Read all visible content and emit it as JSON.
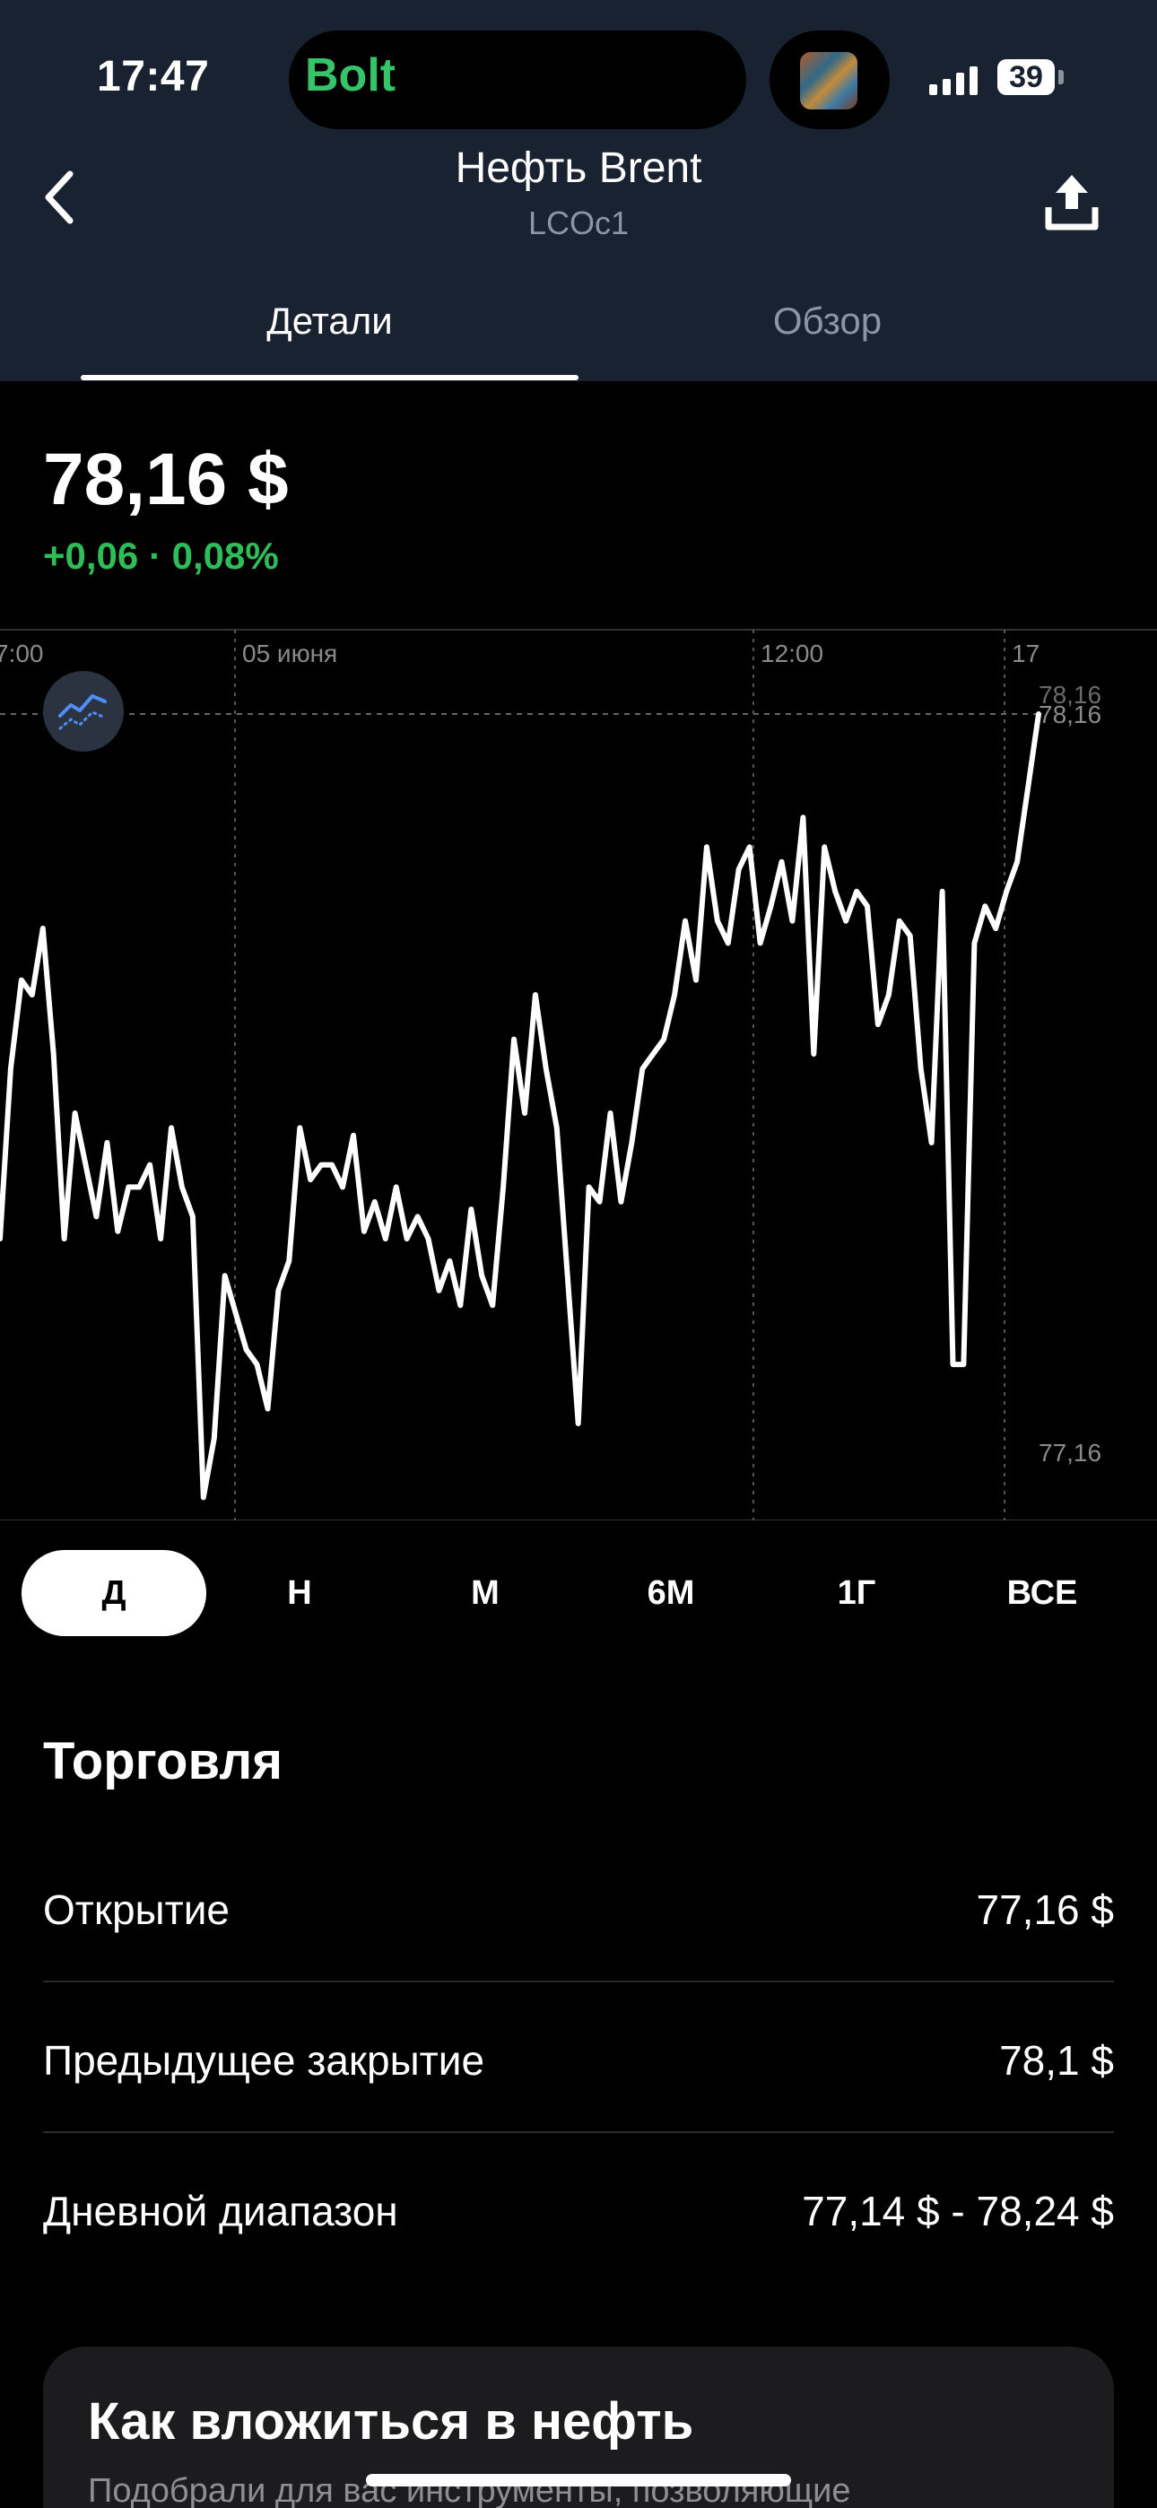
{
  "status_bar": {
    "time": "17:47",
    "island_app": "Bolt",
    "battery": "39"
  },
  "header": {
    "title": "Нефть Brent",
    "ticker": "LCOc1",
    "back_icon": "chevron-left-icon",
    "share_icon": "share-upload-icon"
  },
  "tabs": [
    {
      "label": "Детали",
      "active": true
    },
    {
      "label": "Обзор",
      "active": false
    }
  ],
  "quote": {
    "price": "78,16 $",
    "change": "+0,06 · 0,08%",
    "change_color": "#2ebd59"
  },
  "chart_data": {
    "type": "line",
    "x_tick_labels": [
      "7:00",
      "05 июня",
      "12:00",
      "17"
    ],
    "y_labels": {
      "top_overlay": "78,16",
      "top": "78,16",
      "bottom": "77,16"
    },
    "ylim": [
      77.16,
      78.16
    ],
    "series": [
      {
        "values": [
          77.45,
          77.68,
          77.8,
          77.78,
          77.87,
          77.7,
          77.45,
          77.62,
          77.55,
          77.48,
          77.58,
          77.46,
          77.52,
          77.52,
          77.55,
          77.45,
          77.6,
          77.52,
          77.48,
          77.1,
          77.18,
          77.4,
          77.35,
          77.3,
          77.28,
          77.22,
          77.38,
          77.42,
          77.6,
          77.53,
          77.55,
          77.55,
          77.52,
          77.59,
          77.46,
          77.5,
          77.45,
          77.52,
          77.45,
          77.48,
          77.45,
          77.38,
          77.42,
          77.36,
          77.49,
          77.4,
          77.36,
          77.52,
          77.72,
          77.62,
          77.78,
          77.68,
          77.6,
          77.4,
          77.2,
          77.52,
          77.5,
          77.62,
          77.5,
          77.58,
          77.68,
          77.7,
          77.72,
          77.78,
          77.88,
          77.8,
          77.98,
          77.88,
          77.85,
          77.95,
          77.98,
          77.85,
          77.9,
          77.96,
          77.88,
          78.02,
          77.7,
          77.98,
          77.92,
          77.88,
          77.92,
          77.9,
          77.74,
          77.78,
          77.88,
          77.86,
          77.68,
          77.58,
          77.92,
          77.28,
          77.28,
          77.85,
          77.9,
          77.87,
          77.92,
          77.96,
          78.06,
          78.16
        ],
        "color": "#ffffff"
      }
    ],
    "gridlines": "dotted vertical at time ticks, dashed horizontal at last price"
  },
  "periods": [
    {
      "label": "Д",
      "active": true
    },
    {
      "label": "Н",
      "active": false
    },
    {
      "label": "М",
      "active": false
    },
    {
      "label": "6М",
      "active": false
    },
    {
      "label": "1Г",
      "active": false
    },
    {
      "label": "ВСЕ",
      "active": false
    }
  ],
  "trading": {
    "title": "Торговля",
    "rows": [
      {
        "label": "Открытие",
        "value": "77,16 $"
      },
      {
        "label": "Предыдущее закрытие",
        "value": "78,1 $"
      },
      {
        "label": "Дневной диапазон",
        "value": "77,14 $ - 78,24 $"
      }
    ]
  },
  "card": {
    "title": "Как вложиться в нефть",
    "subtitle": "Подобрали для вас инструменты, позволяющие"
  },
  "indicator_icon": "chart-indicator-icon"
}
